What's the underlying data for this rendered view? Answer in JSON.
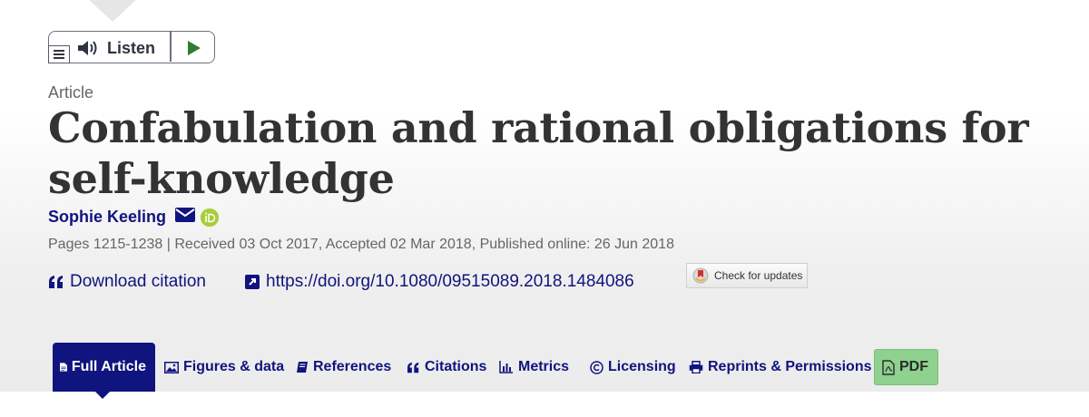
{
  "listen": {
    "label": "Listen"
  },
  "article": {
    "type": "Article",
    "title": "Confabulation and rational obligations for self-knowledge",
    "author": "Sophie Keeling",
    "meta": "Pages 1215-1238 | Received 03 Oct 2017, Accepted 02 Mar 2018, Published online: 26 Jun 2018"
  },
  "links": {
    "download_citation": "Download citation",
    "doi": "https://doi.org/10.1080/09515089.2018.1484086",
    "check_updates": "Check for updates"
  },
  "tabs": {
    "full_article": "Full Article",
    "figures": "Figures & data",
    "references": "References",
    "citations": "Citations",
    "metrics": "Metrics",
    "licensing": "Licensing",
    "reprints": "Reprints & Permissions",
    "pdf": "PDF"
  },
  "colors": {
    "brand": "#10147e",
    "pdf": "#8fd18f",
    "orcid": "#a6ce39"
  }
}
